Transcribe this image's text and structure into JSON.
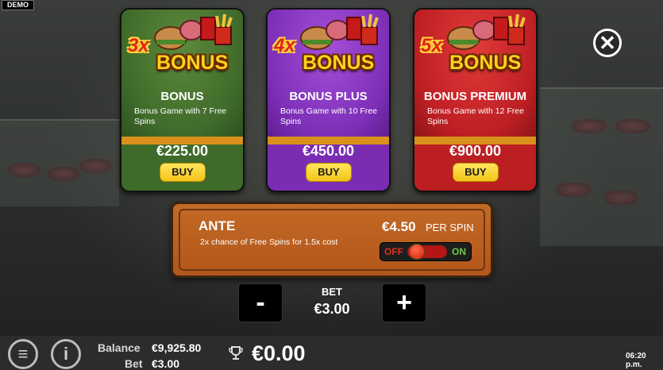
{
  "demo_badge": "DEMO",
  "close_icon": "close-icon",
  "cards": [
    {
      "multiplier": "3x",
      "logo": "BONUS",
      "title": "BONUS",
      "description": "Bonus Game with 7 Free Spins",
      "price": "€225.00",
      "buy_label": "BUY",
      "color": "#3f6a2a"
    },
    {
      "multiplier": "4x",
      "logo": "BONUS",
      "title": "BONUS PLUS",
      "description": "Bonus Game with 10 Free Spins",
      "price": "€450.00",
      "buy_label": "BUY",
      "color": "#7d2fb8"
    },
    {
      "multiplier": "5x",
      "logo": "BONUS",
      "title": "BONUS PREMIUM",
      "description": "Bonus Game with 12 Free Spins",
      "price": "€900.00",
      "buy_label": "BUY",
      "color": "#bd1f23"
    }
  ],
  "ante": {
    "title": "ANTE",
    "description": "2x chance of Free Spins for 1.5x cost",
    "price": "€4.50",
    "unit": "PER SPIN",
    "toggle_off": "OFF",
    "toggle_on": "ON",
    "state": "off"
  },
  "bet_control": {
    "minus": "-",
    "plus": "+",
    "label": "BET",
    "value": "€3.00"
  },
  "status_bar": {
    "balance_label": "Balance",
    "balance_value": "€9,925.80",
    "bet_label": "Bet",
    "bet_value": "€3.00",
    "win_value": "€0.00",
    "time": "06:20 p.m."
  }
}
